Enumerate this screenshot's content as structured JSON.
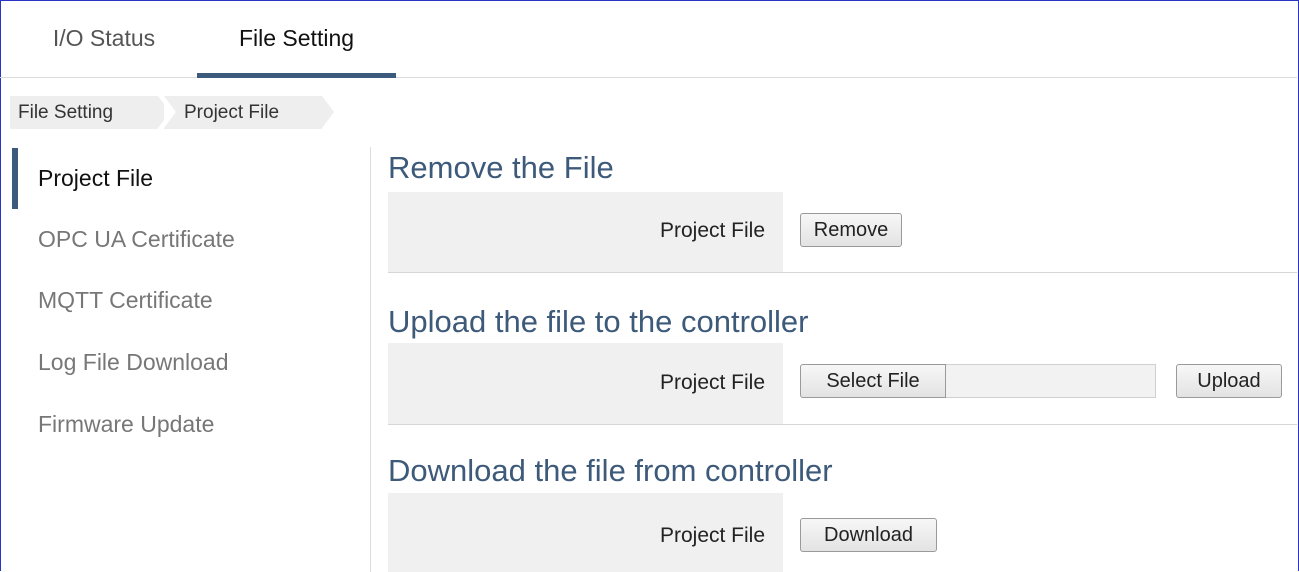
{
  "tabs": [
    {
      "label": "I/O Status",
      "active": false
    },
    {
      "label": "File Setting",
      "active": true
    }
  ],
  "breadcrumb": [
    "File Setting",
    "Project File"
  ],
  "sidebar": {
    "items": [
      {
        "label": "Project File",
        "active": true
      },
      {
        "label": "OPC UA Certificate",
        "active": false
      },
      {
        "label": "MQTT Certificate",
        "active": false
      },
      {
        "label": "Log File Download",
        "active": false
      },
      {
        "label": "Firmware Update",
        "active": false
      }
    ]
  },
  "sections": {
    "remove": {
      "title": "Remove the File",
      "row_label": "Project File",
      "button": "Remove"
    },
    "upload": {
      "title": "Upload the file to the controller",
      "row_label": "Project File",
      "select_button": "Select File",
      "file_name": "",
      "upload_button": "Upload"
    },
    "download": {
      "title": "Download the file from controller",
      "row_label": "Project File",
      "button": "Download"
    }
  },
  "colors": {
    "accent": "#3b5a7c",
    "title": "#3d5a7a",
    "frame_border": "#2a35c8"
  }
}
